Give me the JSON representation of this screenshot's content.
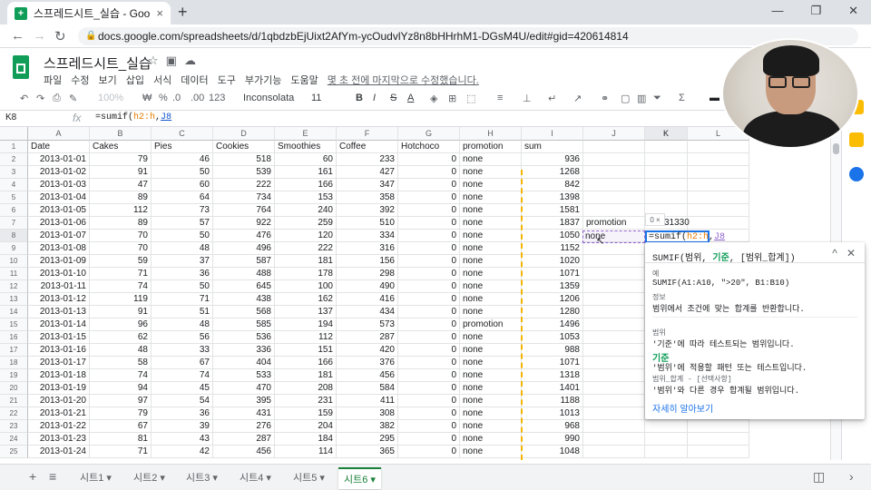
{
  "browser": {
    "tab_title": "스프레드시트_실습 - Google Sh",
    "tab_close": "×",
    "new_tab": "+",
    "url": "docs.google.com/spreadsheets/d/1qbdzbEjUixt2AfYm-ycOudvlYz8n8bHHrhM1-DGsM4U/edit#gid=420614814",
    "win_min": "—",
    "win_max": "❐",
    "win_close": "✕"
  },
  "app": {
    "title": "스프레드시트_실습",
    "menu": [
      "파일",
      "수정",
      "보기",
      "삽입",
      "서식",
      "데이터",
      "도구",
      "부가기능",
      "도움말"
    ],
    "last_edit": "몇 초 전에 마지막으로 수정했습니다."
  },
  "toolbar": {
    "zoom": "100%",
    "currency": "₩",
    "percent": "%",
    "dec_less": ".0",
    "dec_more": ".00",
    "format_more": "123",
    "font": "Inconsolata",
    "size": "11",
    "bold": "B",
    "italic": "I",
    "strike": "S",
    "text_color": "A"
  },
  "formula_bar": {
    "cell_ref": "K8",
    "fx": "fx",
    "prefix": "=sumif(",
    "range1": "h2:h",
    "sep": ",",
    "range2": "J8"
  },
  "columns": [
    "A",
    "B",
    "C",
    "D",
    "E",
    "F",
    "G",
    "H",
    "I",
    "J",
    "K",
    "L"
  ],
  "header_row": [
    "Date",
    "Cakes",
    "Pies",
    "Cookies",
    "Smoothies",
    "Coffee",
    "Hotchoco",
    "promotion",
    "sum"
  ],
  "rows": [
    [
      "2013-01-01",
      "79",
      "46",
      "518",
      "60",
      "233",
      "0",
      "none",
      "936"
    ],
    [
      "2013-01-02",
      "91",
      "50",
      "539",
      "161",
      "427",
      "0",
      "none",
      "1268"
    ],
    [
      "2013-01-03",
      "47",
      "60",
      "222",
      "166",
      "347",
      "0",
      "none",
      "842"
    ],
    [
      "2013-01-04",
      "89",
      "64",
      "734",
      "153",
      "358",
      "0",
      "none",
      "1398"
    ],
    [
      "2013-01-05",
      "112",
      "73",
      "764",
      "240",
      "392",
      "0",
      "none",
      "1581"
    ],
    [
      "2013-01-06",
      "89",
      "57",
      "922",
      "259",
      "510",
      "0",
      "none",
      "1837"
    ],
    [
      "2013-01-07",
      "70",
      "50",
      "476",
      "120",
      "334",
      "0",
      "none",
      "1050"
    ],
    [
      "2013-01-08",
      "70",
      "48",
      "496",
      "222",
      "316",
      "0",
      "none",
      "1152"
    ],
    [
      "2013-01-09",
      "59",
      "37",
      "587",
      "181",
      "156",
      "0",
      "none",
      "1020"
    ],
    [
      "2013-01-10",
      "71",
      "36",
      "488",
      "178",
      "298",
      "0",
      "none",
      "1071"
    ],
    [
      "2013-01-11",
      "74",
      "50",
      "645",
      "100",
      "490",
      "0",
      "none",
      "1359"
    ],
    [
      "2013-01-12",
      "119",
      "71",
      "438",
      "162",
      "416",
      "0",
      "none",
      "1206"
    ],
    [
      "2013-01-13",
      "91",
      "51",
      "568",
      "137",
      "434",
      "0",
      "none",
      "1280"
    ],
    [
      "2013-01-14",
      "96",
      "48",
      "585",
      "194",
      "573",
      "0",
      "promotion",
      "1496"
    ],
    [
      "2013-01-15",
      "62",
      "56",
      "536",
      "112",
      "287",
      "0",
      "none",
      "1053"
    ],
    [
      "2013-01-16",
      "48",
      "33",
      "336",
      "151",
      "420",
      "0",
      "none",
      "988"
    ],
    [
      "2013-01-17",
      "58",
      "67",
      "404",
      "166",
      "376",
      "0",
      "none",
      "1071"
    ],
    [
      "2013-01-18",
      "74",
      "74",
      "533",
      "181",
      "456",
      "0",
      "none",
      "1318"
    ],
    [
      "2013-01-19",
      "94",
      "45",
      "470",
      "208",
      "584",
      "0",
      "none",
      "1401"
    ],
    [
      "2013-01-20",
      "97",
      "54",
      "395",
      "231",
      "411",
      "0",
      "none",
      "1188"
    ],
    [
      "2013-01-21",
      "79",
      "36",
      "431",
      "159",
      "308",
      "0",
      "none",
      "1013"
    ],
    [
      "2013-01-22",
      "67",
      "39",
      "276",
      "204",
      "382",
      "0",
      "none",
      "968"
    ],
    [
      "2013-01-23",
      "81",
      "43",
      "287",
      "184",
      "295",
      "0",
      "none",
      "990"
    ],
    [
      "2013-01-24",
      "71",
      "42",
      "456",
      "114",
      "365",
      "0",
      "none",
      "1048"
    ]
  ],
  "extra_cells": {
    "j7": "promotion",
    "k7": "31330",
    "j8": "none"
  },
  "editor": {
    "chip": "0 ×",
    "prefix": "=sumif(",
    "range1": "h2:h",
    "sep": ",",
    "range2": "J8"
  },
  "help_popup": {
    "sig_prefix": "SUMIF(범위, ",
    "sig_highlight": "기준",
    "sig_suffix": ", [범위_합계])",
    "collapse": "^",
    "close": "✕",
    "example_label": "예",
    "example": "SUMIF(A1:A10, \">20\", B1:B10)",
    "summary_label": "정보",
    "summary": "범위에서 조건에 맞는 합계를 반환합니다.",
    "arg1_name": "범위",
    "arg1_desc": "'기준'에 따라 테스트되는 범위입니다.",
    "arg2_name": "기준",
    "arg2_desc": "'범위'에 적용할 패턴 또는 테스트입니다.",
    "arg3_name": "범위_합계 - [선택사항]",
    "arg3_desc": "'범위'와 다른 경우 합계될 범위입니다.",
    "learn_more": "자세히 알아보기"
  },
  "sheets": [
    "시트1",
    "시트2",
    "시트3",
    "시트4",
    "시트5",
    "시트6"
  ],
  "active_sheet_index": 5,
  "colors": {
    "sheets_green": "#0f9d58",
    "selection_blue": "#1a73e8",
    "dash_orange": "#f4b400",
    "dash_purple": "#8e63ce"
  }
}
